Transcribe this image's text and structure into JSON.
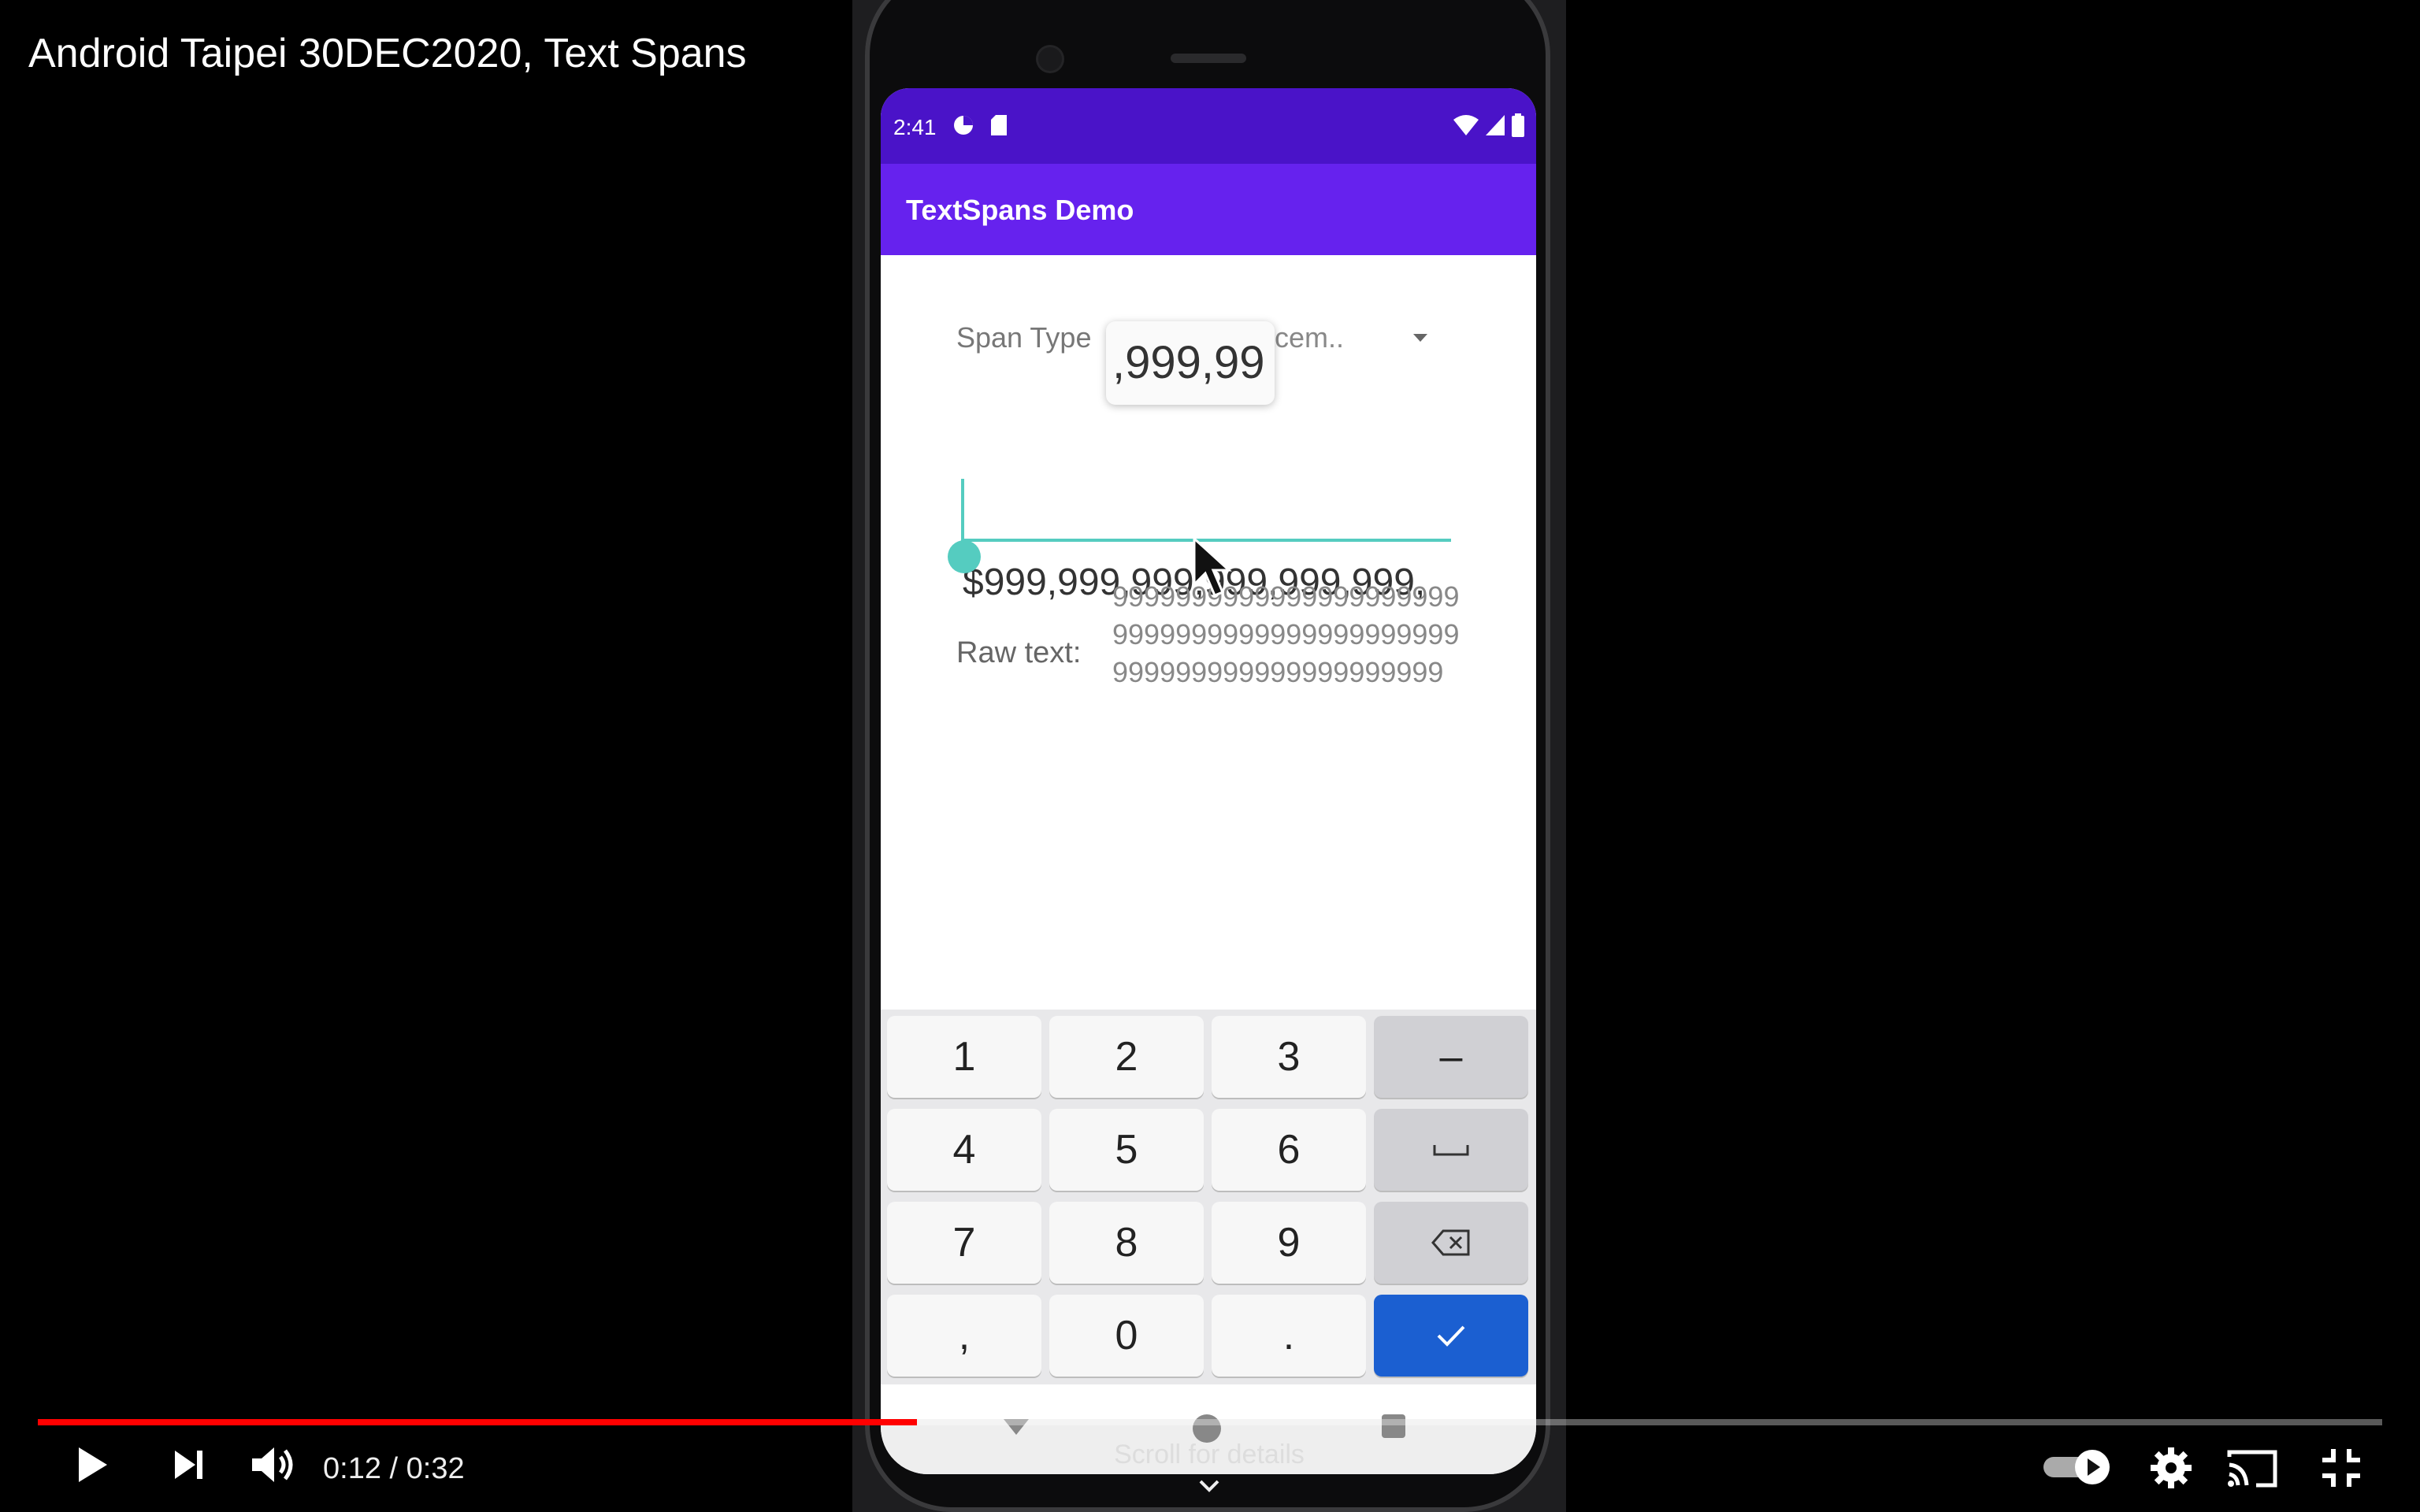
{
  "player": {
    "video_title": "Android Taipei 30DEC2020, Text Spans",
    "current_time": "0:12",
    "duration": "0:32",
    "time_separator": " / ",
    "progress_fraction": 0.375,
    "scroll_hint": "Scroll for details",
    "accent_color": "#ff0000"
  },
  "phone": {
    "status_bar": {
      "time": "2:41",
      "color": "#4a13c8"
    },
    "app_bar": {
      "title": "TextSpans Demo",
      "color": "#6622ee"
    },
    "form": {
      "span_type_label": "Span Type",
      "span_type_value": "acem..",
      "magnifier_text": ",999,99",
      "amount_value": "$999,999,999,999,999,999,",
      "raw_text_label": "Raw text:",
      "raw_text_value": "99999999999999999999999999999999999999999999999999999999999999999",
      "accent_color": "#55ccc0"
    },
    "keyboard": {
      "rows": [
        [
          "1",
          "2",
          "3",
          "–"
        ],
        [
          "4",
          "5",
          "6",
          "space"
        ],
        [
          "7",
          "8",
          "9",
          "backspace"
        ],
        [
          ",",
          "0",
          ".",
          "done"
        ]
      ],
      "row1": {
        "k1": "1",
        "k2": "2",
        "k3": "3",
        "k4": "–"
      },
      "row2": {
        "k1": "4",
        "k2": "5",
        "k3": "6"
      },
      "row3": {
        "k1": "7",
        "k2": "8",
        "k3": "9"
      },
      "row4": {
        "k1": ",",
        "k2": "0",
        "k3": "."
      }
    }
  }
}
